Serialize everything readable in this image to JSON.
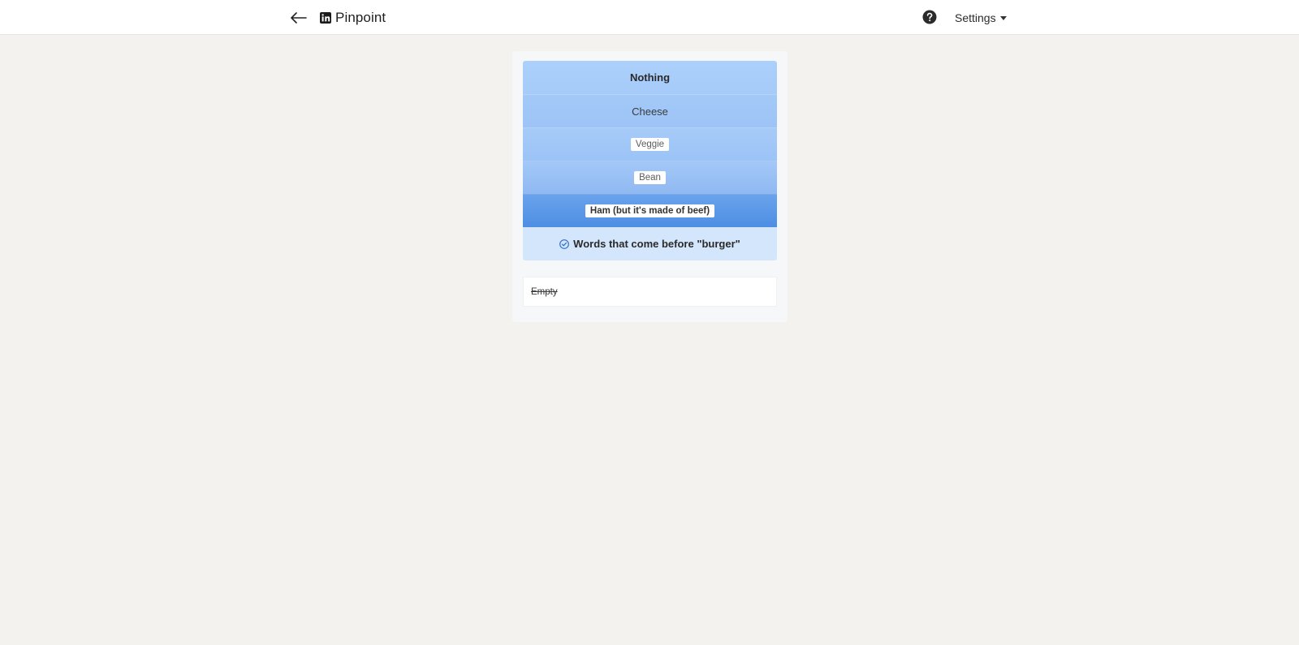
{
  "header": {
    "back_icon": "arrow-left-icon",
    "brand_icon": "linkedin-icon",
    "title": "Pinpoint",
    "help_icon": "question-circle-icon",
    "settings_label": "Settings"
  },
  "game": {
    "clues": [
      {
        "label": "Nothing",
        "style": "plain"
      },
      {
        "label": "Cheese",
        "style": "plain"
      },
      {
        "label": "Veggie",
        "style": "chip"
      },
      {
        "label": "Bean",
        "style": "chip"
      },
      {
        "label": "Ham (but it's made of beef)",
        "style": "chip"
      }
    ],
    "answer": {
      "icon": "check-circle-icon",
      "text": "Words that come before \"burger\""
    },
    "guesses": [
      {
        "text": "Empty",
        "status": "incorrect"
      }
    ]
  },
  "colors": {
    "page_background": "#f3f2ef",
    "clue_light": "#acd0fb",
    "clue_dark": "#4d8ee3",
    "answer_background": "#d4e6fc",
    "check_icon": "#2f6fd1"
  }
}
